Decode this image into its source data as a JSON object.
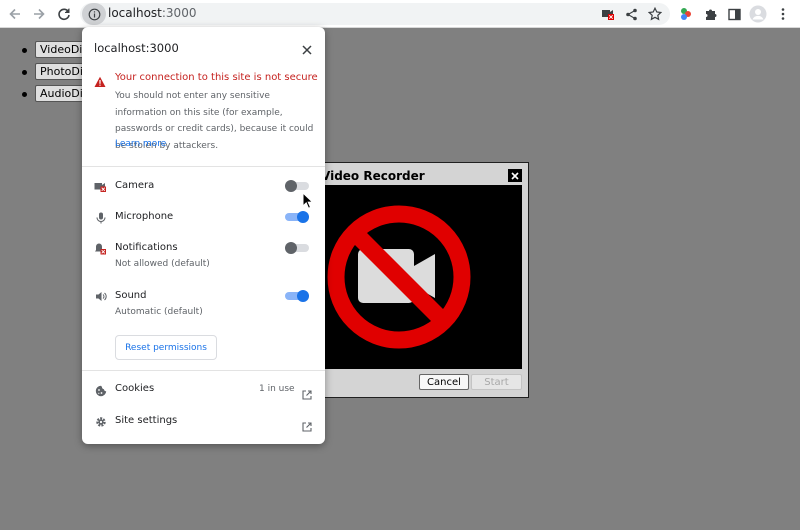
{
  "browser": {
    "url_host": "localhost",
    "url_port": ":3000"
  },
  "page": {
    "buttons": [
      "VideoDialog",
      "PhotoDialog",
      "AudioDialog"
    ]
  },
  "dialog": {
    "title": "Video Recorder",
    "cancel_label": "Cancel",
    "start_label": "Start"
  },
  "popup": {
    "title": "localhost:3000",
    "warning_title": "Your connection to this site is not secure",
    "warning_body": "You should not enter any sensitive information on this site (for example, passwords or credit cards), because it could be stolen by attackers.",
    "learn_more": "Learn more",
    "permissions": [
      {
        "label": "Camera",
        "sub": "",
        "enabled": false,
        "icon": "camera-blocked-icon"
      },
      {
        "label": "Microphone",
        "sub": "",
        "enabled": true,
        "icon": "microphone-icon"
      },
      {
        "label": "Notifications",
        "sub": "Not allowed (default)",
        "enabled": false,
        "icon": "notifications-blocked-icon"
      },
      {
        "label": "Sound",
        "sub": "Automatic (default)",
        "enabled": true,
        "icon": "sound-icon"
      }
    ],
    "reset_label": "Reset permissions",
    "cookies_label": "Cookies",
    "cookies_value": "1 in use",
    "site_settings_label": "Site settings"
  },
  "colors": {
    "accent": "#1a73e8",
    "warning": "#c5221f",
    "blocked_sign": "#e00000"
  }
}
